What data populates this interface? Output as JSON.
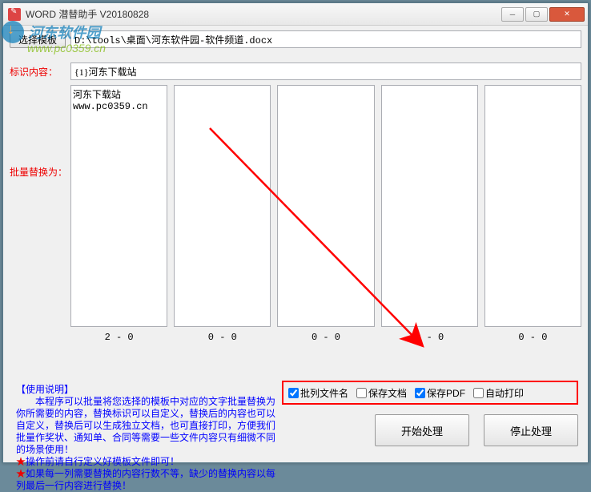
{
  "window": {
    "title": "WORD 潜替助手 V20180828"
  },
  "toolbar": {
    "select_template_btn": "选择模板",
    "path_value": "D:\\tools\\桌面\\河东软件园-软件频道.docx"
  },
  "labels": {
    "marker_content": "标识内容：",
    "batch_replace": "批量替换为："
  },
  "marker_value": "{1}河东下载站",
  "columns": [
    {
      "content": "河东下载站\nwww.pc0359.cn",
      "count": "2 - 0"
    },
    {
      "content": "",
      "count": "0 - 0"
    },
    {
      "content": "",
      "count": "0 - 0"
    },
    {
      "content": "",
      "count": "0 - 0"
    },
    {
      "content": "",
      "count": "0 - 0"
    }
  ],
  "instructions": {
    "heading": "【使用说明】",
    "line1": "　　本程序可以批量将您选择的模板中对应的文字批量替换为你所需要的内容，替换标识可以自定义，替换后的内容也可以自定义，替换后可以生成独立文档，也可直接打印，方便我们批量作奖状、通知单、合同等需要一些文件内容只有细微不同的场景使用！",
    "star1": "★",
    "line2": "操作前请自行定义好模板文件即可！",
    "star2": "★",
    "line3": "如果每一列需要替换的内容行数不等，缺少的替换内容以每列最后一行内容进行替换！"
  },
  "options": {
    "batch_filename": {
      "label": "批列文件名",
      "checked": true
    },
    "save_doc": {
      "label": "保存文档",
      "checked": false
    },
    "save_pdf": {
      "label": "保存PDF",
      "checked": true
    },
    "auto_print": {
      "label": "自动打印",
      "checked": false
    }
  },
  "buttons": {
    "start": "开始处理",
    "stop": "停止处理"
  },
  "watermark": {
    "text": "河东软件园",
    "url": "www.pc0359.cn"
  }
}
